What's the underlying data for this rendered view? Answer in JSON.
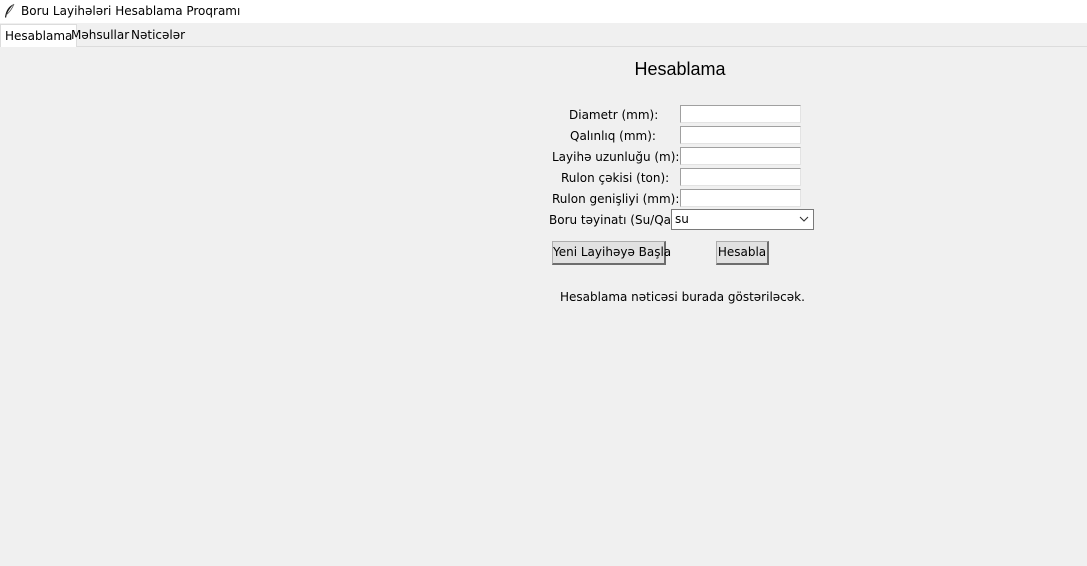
{
  "window": {
    "title": "Boru Layihələri Hesablama Proqramı",
    "icon": "feather-icon"
  },
  "tabs": [
    {
      "label": "Hesablama",
      "active": true
    },
    {
      "label": "Məhsullar",
      "active": false
    },
    {
      "label": "Nəticələr",
      "active": false
    }
  ],
  "form": {
    "title": "Hesablama",
    "fields": [
      {
        "label": "Diametr (mm):",
        "value": ""
      },
      {
        "label": "Qalınlıq (mm):",
        "value": ""
      },
      {
        "label": "Layihə uzunluğu (m):",
        "value": ""
      },
      {
        "label": "Rulon çəkisi (ton):",
        "value": ""
      },
      {
        "label": "Rulon genişliyi (mm):",
        "value": ""
      }
    ],
    "purpose": {
      "label": "Boru təyinatı (Su/Qaz):",
      "selected": "su"
    },
    "buttons": {
      "new_project": "Yeni Layihəyə Başla",
      "calculate": "Hesabla"
    },
    "result_text": "Hesablama nəticəsi burada göstəriləcək."
  }
}
